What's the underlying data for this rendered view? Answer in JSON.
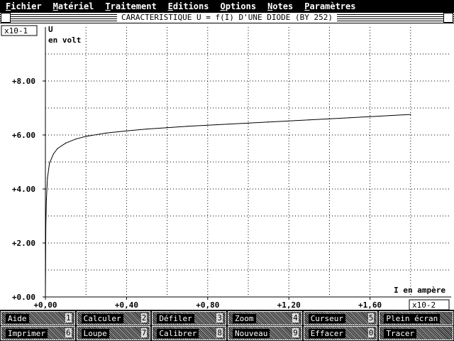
{
  "menu": [
    {
      "label": "Fichier",
      "hot": "F"
    },
    {
      "label": "Matériel",
      "hot": "M"
    },
    {
      "label": "Traitement",
      "hot": "T"
    },
    {
      "label": "Editions",
      "hot": "E"
    },
    {
      "label": "Options",
      "hot": "O"
    },
    {
      "label": "Notes",
      "hot": "N"
    },
    {
      "label": "Paramètres",
      "hot": "P"
    }
  ],
  "window": {
    "title": "CARACTERISTIQUE U = f(I) D'UNE DIODE (BY 252)"
  },
  "plot": {
    "y_scale": "x10-1",
    "x_scale": "x10-2",
    "y_title_line1": "U",
    "y_title_line2": "en volt",
    "x_title": "I en ampère",
    "y_ticks": [
      "+0.00",
      "+2.00",
      "+4.00",
      "+6.00",
      "+8.00"
    ],
    "x_ticks": [
      "+0,00",
      "+0,40",
      "+0,80",
      "+1,20",
      "+1,60"
    ]
  },
  "chart_data": {
    "type": "line",
    "xlabel": "I en ampère",
    "ylabel": "U en volt",
    "xlim": [
      0,
      2.0
    ],
    "ylim": [
      0,
      10.0
    ],
    "x_scale_factor": "x10-2",
    "y_scale_factor": "x10-1",
    "grid": true,
    "x": [
      0.0,
      0.002,
      0.005,
      0.01,
      0.02,
      0.04,
      0.06,
      0.1,
      0.15,
      0.2,
      0.3,
      0.4,
      0.5,
      0.6,
      0.7,
      0.8,
      0.9,
      1.0,
      1.1,
      1.2,
      1.3,
      1.4,
      1.5,
      1.6,
      1.7,
      1.8
    ],
    "y": [
      0.0,
      2.6,
      3.6,
      4.4,
      4.95,
      5.3,
      5.5,
      5.7,
      5.85,
      5.95,
      6.07,
      6.15,
      6.22,
      6.27,
      6.32,
      6.36,
      6.4,
      6.44,
      6.48,
      6.52,
      6.56,
      6.6,
      6.64,
      6.68,
      6.72,
      6.76
    ]
  },
  "buttons_row1": [
    {
      "label": "Aide",
      "key": "1"
    },
    {
      "label": "Calculer",
      "key": "2"
    },
    {
      "label": "Défiler",
      "key": "3"
    },
    {
      "label": "Zoom",
      "key": "4"
    },
    {
      "label": "Curseur",
      "key": "5"
    },
    {
      "label": "Plein écran",
      "key": ""
    }
  ],
  "buttons_row2": [
    {
      "label": "Imprimer",
      "key": "6"
    },
    {
      "label": "Loupe",
      "key": "7"
    },
    {
      "label": "Calibrer",
      "key": "8"
    },
    {
      "label": "Nouveau",
      "key": "9"
    },
    {
      "label": "Effacer",
      "key": "0"
    },
    {
      "label": "Tracer",
      "key": ""
    }
  ]
}
